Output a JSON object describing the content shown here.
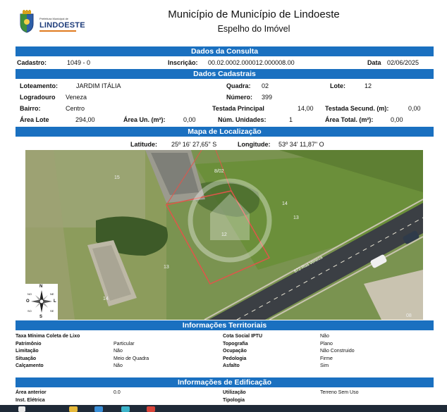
{
  "header": {
    "logo_small": "Prefeitura Municipal de",
    "logo_name": "LINDOESTE",
    "title": "Município de Município de Lindoeste",
    "subtitle": "Espelho do Imóvel"
  },
  "consulta": {
    "section_title": "Dados da Consulta",
    "cadastro_label": "Cadastro:",
    "cadastro_value": "1049 - 0",
    "inscricao_label": "Inscrição:",
    "inscricao_value": "00.02.0002.000012.000008.00",
    "data_label": "Data",
    "data_value": "02/06/2025"
  },
  "cadastrais": {
    "section_title": "Dados Cadastrais",
    "loteamento_label": "Loteamento:",
    "loteamento_value": "JARDIM ITÁLIA",
    "quadra_label": "Quadra:",
    "quadra_value": "02",
    "lote_label": "Lote:",
    "lote_value": "12",
    "logradouro_label": "Logradouro",
    "logradouro_value": "Veneza",
    "numero_label": "Número:",
    "numero_value": "399",
    "bairro_label": "Bairro:",
    "bairro_value": "Centro",
    "testada_principal_label": "Testada Principal",
    "testada_principal_value": "14,00",
    "testada_secund_label": "Testada Secund. (m):",
    "testada_secund_value": "0,00",
    "area_lote_label": "Área Lote",
    "area_lote_value": "294,00",
    "area_un_label": "Área Un. (m²):",
    "area_un_value": "0,00",
    "num_unidades_label": "Núm. Unidades:",
    "num_unidades_value": "1",
    "area_total_label": "Área Total. (m²):",
    "area_total_value": "0,00"
  },
  "mapa": {
    "section_title": "Mapa de Localização",
    "latitude_label": "Latitude:",
    "latitude_value": "25º 16' 27,65\" S",
    "longitude_label": "Longitude:",
    "longitude_value": "53º 34' 11,87\" O",
    "block_label": "8/02",
    "lot_labels": [
      "15",
      "14",
      "13",
      "12",
      "13",
      "14",
      "08"
    ],
    "street_label": "672-Rua Veneza",
    "compass": {
      "n": "N",
      "s": "S",
      "l": "L",
      "o": "O",
      "no": "NO",
      "ne": "NE",
      "so": "SO",
      "se": "SE"
    },
    "colors": {
      "lot_outline": "#e0554a",
      "road": "#3b3f44",
      "vegetation": "#6f8a45"
    }
  },
  "territoriais": {
    "section_title": "Informações Territoriais",
    "left": [
      {
        "label": "Taxa Mínima Coleta de Lixo",
        "value": ""
      },
      {
        "label": "Patrimônio",
        "value": "Particular"
      },
      {
        "label": "Limitação",
        "value": "Não"
      },
      {
        "label": "Situação",
        "value": "Meio de Quadra"
      },
      {
        "label": "Calçamento",
        "value": "Não"
      }
    ],
    "right": [
      {
        "label": "Cota Social IPTU",
        "value": "Não"
      },
      {
        "label": "Topografia",
        "value": "Plano"
      },
      {
        "label": "Ocupação",
        "value": "Não Construido"
      },
      {
        "label": "Pedologia",
        "value": "Firme"
      },
      {
        "label": "Asfalto",
        "value": "Sim"
      }
    ]
  },
  "edificacao": {
    "section_title": "Informações de Edificação",
    "left": [
      {
        "label": "Área anterior",
        "value": "0.0"
      },
      {
        "label": "Inst. Elétrica",
        "value": ""
      }
    ],
    "right": [
      {
        "label": "Utilização",
        "value": "Terreno Sem Uso"
      },
      {
        "label": "Tipologia",
        "value": ""
      }
    ]
  }
}
